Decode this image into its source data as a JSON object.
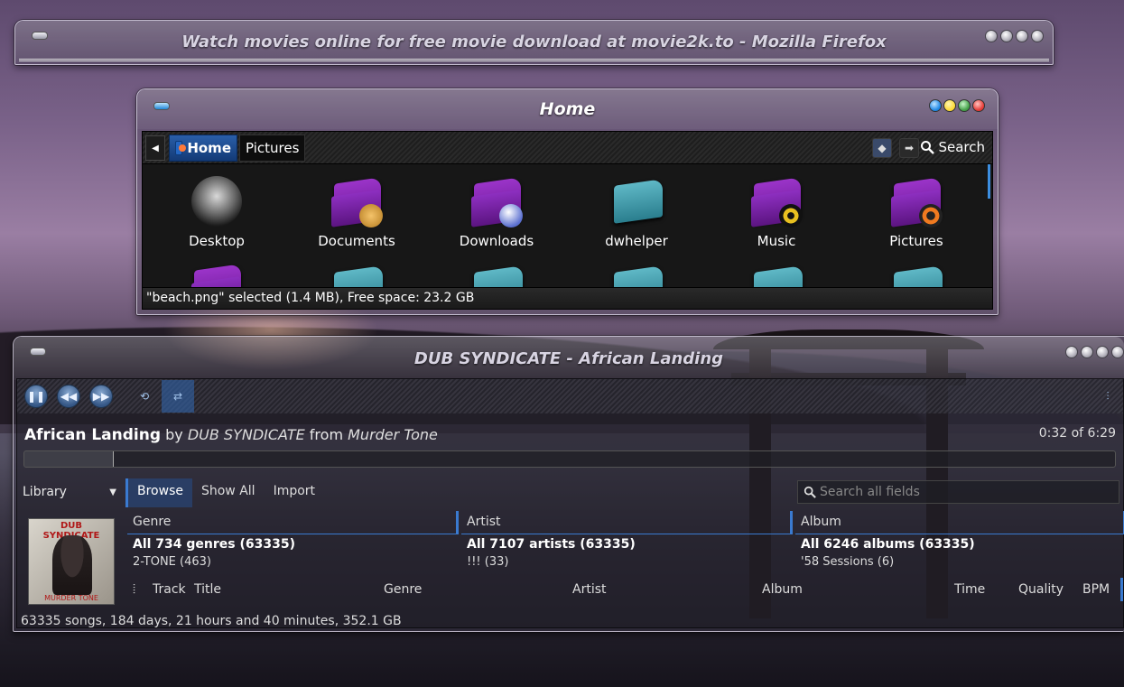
{
  "firefox": {
    "title": "Watch movies online for free movie download at movie2k.to - Mozilla Firefox"
  },
  "file_manager": {
    "title": "Home",
    "breadcrumbs": [
      "Home",
      "Pictures"
    ],
    "search_label": "Search",
    "files_row1": [
      {
        "name": "Desktop",
        "icon": "desktop-icon"
      },
      {
        "name": "Documents",
        "icon": "documents-folder-icon"
      },
      {
        "name": "Downloads",
        "icon": "downloads-folder-icon"
      },
      {
        "name": "dwhelper",
        "icon": "folder-icon"
      },
      {
        "name": "Music",
        "icon": "music-folder-icon"
      },
      {
        "name": "Pictures",
        "icon": "pictures-folder-icon"
      }
    ],
    "status": "\"beach.png\" selected (1.4 MB), Free space: 23.2 GB",
    "colors": {
      "close": "#e53935",
      "maximize": "#43a047",
      "minimize": "#fdd835",
      "menu": "#1e88e5"
    }
  },
  "player": {
    "title": "DUB SYNDICATE - African Landing",
    "track": "African Landing",
    "by_label": "by",
    "artist": "DUB SYNDICATE",
    "from_label": "from",
    "album": "Murder Tone",
    "position": "0:32 of 6:29",
    "progress_fraction": 0.082,
    "library_label": "Library",
    "tabs": [
      "Browse",
      "Show All",
      "Import"
    ],
    "search_placeholder": "Search all fields",
    "cover": {
      "title": "DUB SYNDICATE",
      "subtitle": "MURDER TONE"
    },
    "browser": {
      "genre": {
        "header": "Genre",
        "all": "All 734 genres (63335)",
        "first": "2-TONE (463)"
      },
      "artist": {
        "header": "Artist",
        "all": "All 7107 artists (63335)",
        "first": "!!! (33)"
      },
      "album": {
        "header": "Album",
        "all": "All 6246 albums (63335)",
        "first": "'58 Sessions (6)"
      }
    },
    "columns": [
      "Track",
      "Title",
      "Genre",
      "Artist",
      "Album",
      "Time",
      "Quality",
      "BPM"
    ],
    "status": "63335 songs, 184 days, 21 hours and 40 minutes, 352.1 GB"
  }
}
